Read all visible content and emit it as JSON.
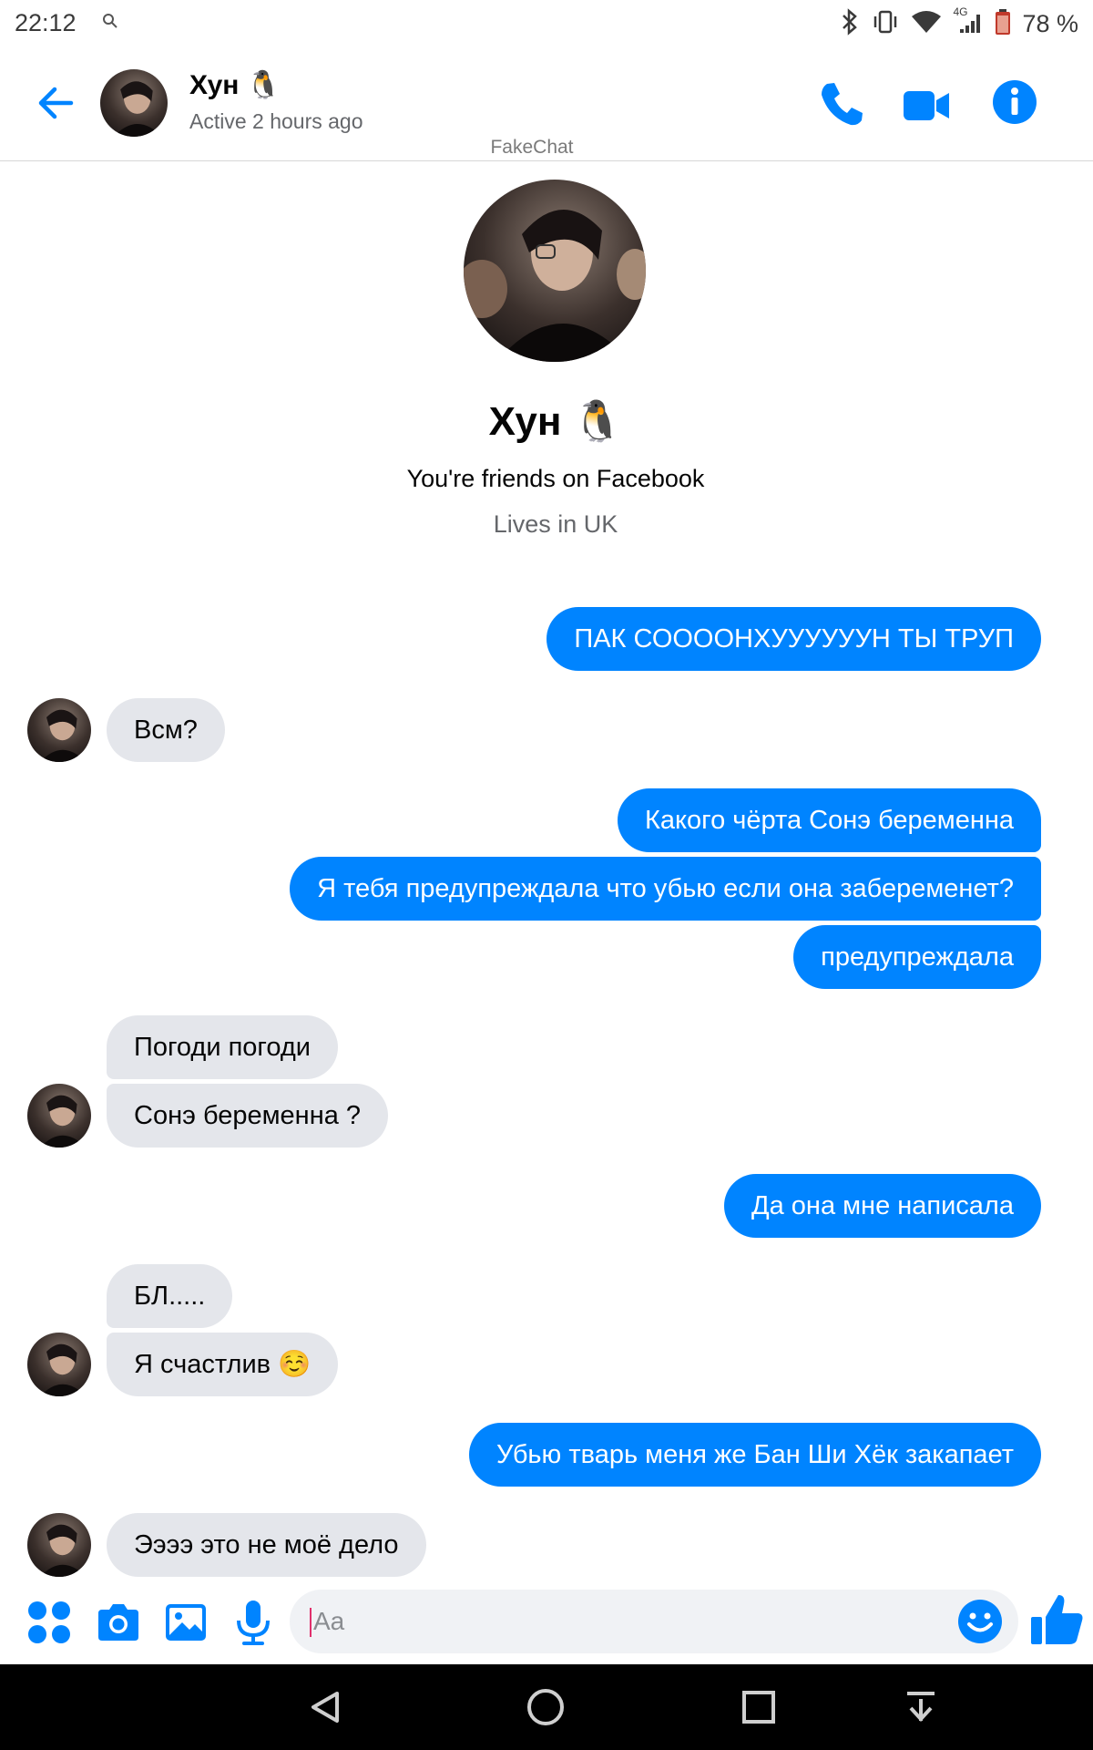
{
  "status_bar": {
    "time": "22:12",
    "network": "4G",
    "battery": "78 %",
    "icons": [
      "search-icon",
      "bluetooth-icon",
      "vibrate-icon",
      "wifi-icon",
      "signal-icon",
      "battery-icon"
    ]
  },
  "header": {
    "name": "Хун 🐧",
    "status": "Active 2 hours ago",
    "actions": [
      "back-arrow-icon",
      "phone-icon",
      "video-camera-icon",
      "info-icon"
    ]
  },
  "watermark": "FakeChat",
  "profile": {
    "name": "Хун 🐧",
    "friends_text": "You're friends on Facebook",
    "location": "Lives in UK"
  },
  "messages": [
    {
      "side": "out",
      "text": "ПАК СООООНХУУУУУУН ТЫ ТРУП"
    },
    {
      "side": "in",
      "text": "Всм?"
    },
    {
      "side": "out",
      "text": "Какого чёрта Сонэ беременна"
    },
    {
      "side": "out",
      "text": "Я тебя предупреждала что убью если она забеременет?"
    },
    {
      "side": "out",
      "text": "предупреждала"
    },
    {
      "side": "in",
      "text": "Погоди погоди"
    },
    {
      "side": "in",
      "text": "Сонэ беременна ?"
    },
    {
      "side": "out",
      "text": "Да она мне написала"
    },
    {
      "side": "in",
      "text": "БЛ....."
    },
    {
      "side": "in",
      "text": "Я счастлив ☺️"
    },
    {
      "side": "out",
      "text": "Убью тварь меня же Бан Ши Хёк закапает"
    },
    {
      "side": "in",
      "text": "Ээээ это не моё дело"
    }
  ],
  "composer": {
    "placeholder": "Aa",
    "icons": [
      "apps-icon",
      "camera-icon",
      "gallery-icon",
      "microphone-icon",
      "emoji-icon",
      "thumbs-up-icon"
    ]
  },
  "colors": {
    "accent": "#0084ff",
    "incoming_bubble": "#e4e6eb",
    "secondary_text": "#65676b"
  },
  "nav_bar": [
    "back-icon",
    "home-icon",
    "recents-icon",
    "notification-pull-icon"
  ]
}
